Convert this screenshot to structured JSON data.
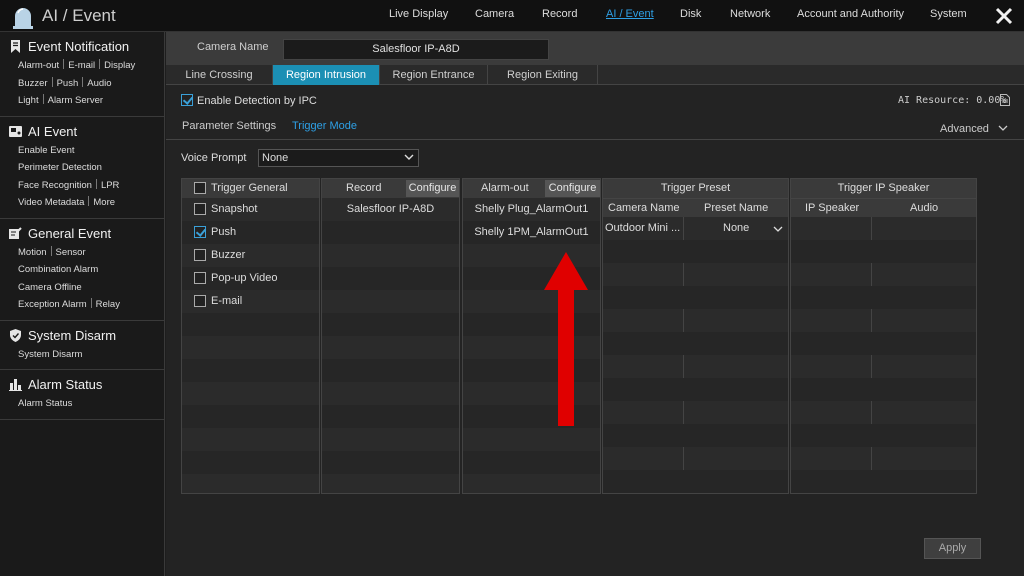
{
  "app": {
    "title": "AI / Event",
    "icon": "alarm-bell-icon"
  },
  "topnav": [
    {
      "label": "Live Display",
      "active": false
    },
    {
      "label": "Camera",
      "active": false
    },
    {
      "label": "Record",
      "active": false
    },
    {
      "label": "AI / Event",
      "active": true
    },
    {
      "label": "Disk",
      "active": false
    },
    {
      "label": "Network",
      "active": false
    },
    {
      "label": "Account and Authority",
      "active": false
    },
    {
      "label": "System",
      "active": false
    }
  ],
  "sidebar": {
    "event_notification": {
      "title": "Event Notification",
      "icon": "bookmark-icon",
      "lines": [
        [
          "Alarm-out",
          "E-mail",
          "Display"
        ],
        [
          "Buzzer",
          "Push",
          "Audio"
        ],
        [
          "Light",
          "Alarm Server"
        ]
      ]
    },
    "ai_event": {
      "title": "AI Event",
      "icon": "ai-camera-icon",
      "lines": [
        [
          "Enable Event"
        ],
        [
          "Perimeter Detection"
        ],
        [
          "Face Recognition",
          "LPR"
        ],
        [
          "Video Metadata",
          "More"
        ]
      ]
    },
    "general_event": {
      "title": "General Event",
      "icon": "edit-event-icon",
      "lines": [
        [
          "Motion",
          "Sensor"
        ],
        [
          "Combination Alarm"
        ],
        [
          "Camera Offline"
        ],
        [
          "Exception Alarm",
          "Relay"
        ]
      ]
    },
    "system_disarm": {
      "title": "System Disarm",
      "icon": "shield-icon",
      "lines": [
        [
          "System Disarm"
        ]
      ]
    },
    "alarm_status": {
      "title": "Alarm Status",
      "icon": "bar-chart-icon",
      "lines": [
        [
          "Alarm Status"
        ]
      ]
    }
  },
  "camera": {
    "label": "Camera Name",
    "value": "Salesfloor IP-A8D"
  },
  "tabs": [
    "Line Crossing",
    "Region Intrusion",
    "Region Entrance",
    "Region Exiting"
  ],
  "active_tab": "Region Intrusion",
  "enable_detection": {
    "label": "Enable Detection by IPC",
    "checked": true
  },
  "ai_resource": "AI Resource: 0.00%",
  "subtabs": [
    "Parameter Settings",
    "Trigger Mode"
  ],
  "active_subtab": "Trigger Mode",
  "advanced": "Advanced",
  "voice_prompt": {
    "label": "Voice Prompt",
    "value": "None"
  },
  "trigger_general": {
    "header": "Trigger General",
    "items": [
      {
        "label": "Snapshot",
        "checked": false
      },
      {
        "label": "Push",
        "checked": true
      },
      {
        "label": "Buzzer",
        "checked": false
      },
      {
        "label": "Pop-up Video",
        "checked": false
      },
      {
        "label": "E-mail",
        "checked": false
      }
    ]
  },
  "record": {
    "header": "Record",
    "configure": "Configure",
    "items": [
      "Salesfloor IP-A8D"
    ]
  },
  "alarm_out": {
    "header": "Alarm-out",
    "configure": "Configure",
    "items": [
      "Shelly Plug_AlarmOut1",
      "Shelly 1PM_AlarmOut1"
    ]
  },
  "trigger_preset": {
    "header": "Trigger Preset",
    "col_camera": "Camera Name",
    "col_preset": "Preset Name",
    "rows": [
      {
        "camera": "Outdoor Mini ...",
        "preset": "None"
      }
    ]
  },
  "trigger_ip_speaker": {
    "header": "Trigger IP Speaker",
    "col_speaker": "IP Speaker",
    "col_audio": "Audio"
  },
  "apply": "Apply",
  "colors": {
    "accent": "#1b8fb4",
    "link": "#2ea0e6",
    "arrow": "#e00000"
  }
}
